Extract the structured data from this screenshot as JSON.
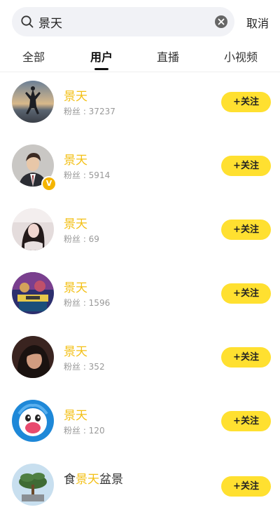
{
  "search": {
    "query": "景天",
    "cancel_label": "取消"
  },
  "tabs": [
    {
      "label": "全部"
    },
    {
      "label": "用户"
    },
    {
      "label": "直播"
    },
    {
      "label": "小视频"
    }
  ],
  "active_tab": "用户",
  "follow_label": "+关注",
  "users": [
    {
      "name": "景天",
      "fans": "粉丝 : 37237",
      "verified": false
    },
    {
      "name": "景天",
      "fans": "粉丝 : 5914",
      "verified": true
    },
    {
      "name": "景天",
      "fans": "粉丝 : 69",
      "verified": false
    },
    {
      "name": "景天",
      "fans": "粉丝 : 1596",
      "verified": false
    },
    {
      "name": "景天",
      "fans": "粉丝 : 352",
      "verified": false
    },
    {
      "name": "景天",
      "fans": "粉丝 : 120",
      "verified": false
    },
    {
      "name_parts": [
        "食",
        "景天",
        "盆景"
      ],
      "fans": "",
      "verified": false
    }
  ],
  "colors": {
    "highlight": "#f3c017",
    "follow_button": "#ffe030",
    "search_bg": "#f1f2f6"
  }
}
